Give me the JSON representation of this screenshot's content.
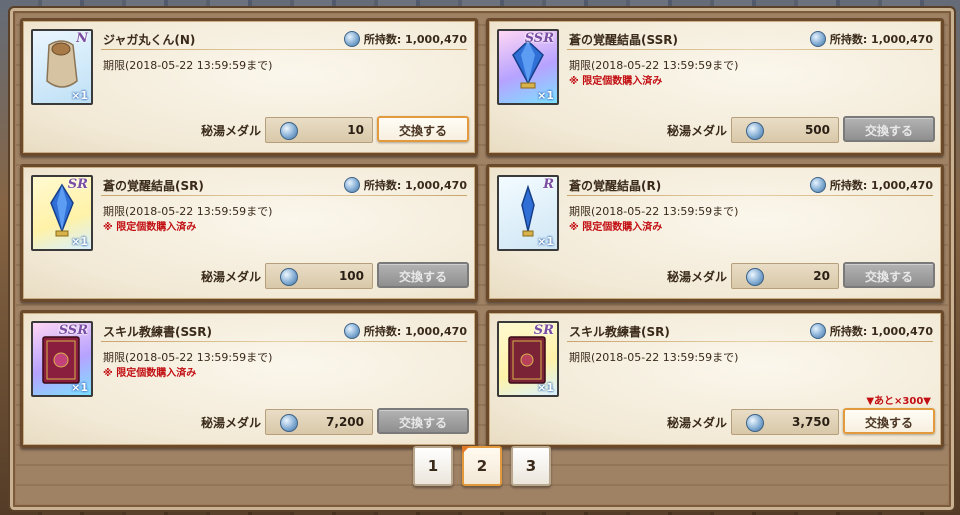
{
  "currency_label": "秘湯メダル",
  "owned_label": "所持数: 1,000,470",
  "items": [
    {
      "name": "ジャガ丸くん(N)",
      "rarity": "N",
      "qty": "×1",
      "limit": "期限(2018-05-22 13:59:59まで)",
      "limited_note": "",
      "price": "10",
      "button": "交換する",
      "button_enabled": true,
      "remaining": ""
    },
    {
      "name": "蒼の覚醒結晶(SSR)",
      "rarity": "SSR",
      "qty": "×1",
      "limit": "期限(2018-05-22 13:59:59まで)",
      "limited_note": "※ 限定個数購入済み",
      "price": "500",
      "button": "交換する",
      "button_enabled": false,
      "remaining": ""
    },
    {
      "name": "蒼の覚醒結晶(SR)",
      "rarity": "SR",
      "qty": "×1",
      "limit": "期限(2018-05-22 13:59:59まで)",
      "limited_note": "※ 限定個数購入済み",
      "price": "100",
      "button": "交換する",
      "button_enabled": false,
      "remaining": ""
    },
    {
      "name": "蒼の覚醒結晶(R)",
      "rarity": "R",
      "qty": "×1",
      "limit": "期限(2018-05-22 13:59:59まで)",
      "limited_note": "※ 限定個数購入済み",
      "price": "20",
      "button": "交換する",
      "button_enabled": false,
      "remaining": ""
    },
    {
      "name": "スキル教練書(SSR)",
      "rarity": "SSR",
      "qty": "×1",
      "limit": "期限(2018-05-22 13:59:59まで)",
      "limited_note": "※ 限定個数購入済み",
      "price": "7,200",
      "button": "交換する",
      "button_enabled": false,
      "remaining": ""
    },
    {
      "name": "スキル教練書(SR)",
      "rarity": "SR",
      "qty": "×1",
      "limit": "期限(2018-05-22 13:59:59まで)",
      "limited_note": "",
      "price": "3,750",
      "button": "交換する",
      "button_enabled": true,
      "remaining": "▼あと×300▼"
    }
  ],
  "pager": {
    "pages": [
      "1",
      "2",
      "3"
    ],
    "current": "2"
  },
  "icons": {
    "medal": "medal-icon",
    "potato": "potato-bag-icon",
    "crystal": "blue-crystal-icon",
    "book": "skill-book-icon"
  }
}
